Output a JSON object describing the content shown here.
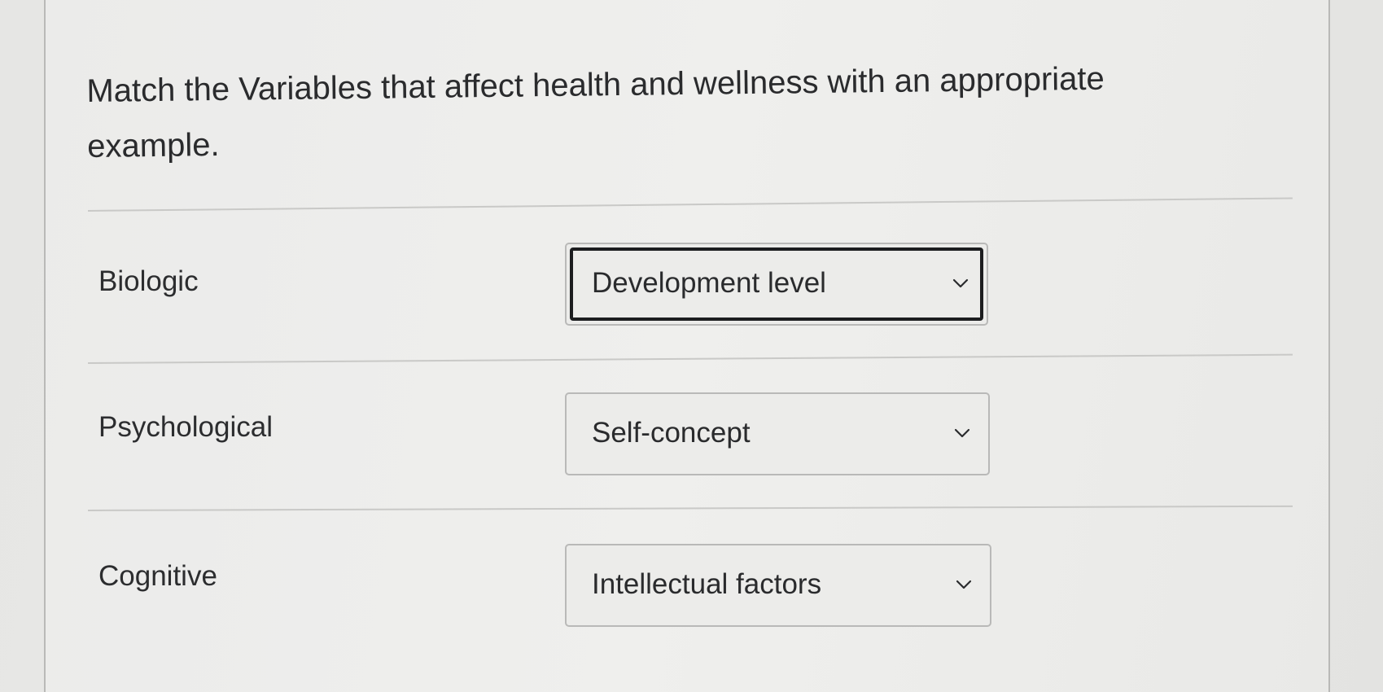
{
  "question": {
    "text": "Match the Variables that affect health and wellness with an appropriate example."
  },
  "matches": [
    {
      "label": "Biologic",
      "selected": "Development level"
    },
    {
      "label": "Psychological",
      "selected": "Self-concept"
    },
    {
      "label": "Cognitive",
      "selected": "Intellectual factors"
    }
  ],
  "icons": {
    "dropdown": "chevron-down-icon"
  },
  "colors": {
    "text": "#2a2b2d",
    "background": "#ececea",
    "border": "#b9b9b8",
    "focus": "#1c1d1f"
  }
}
